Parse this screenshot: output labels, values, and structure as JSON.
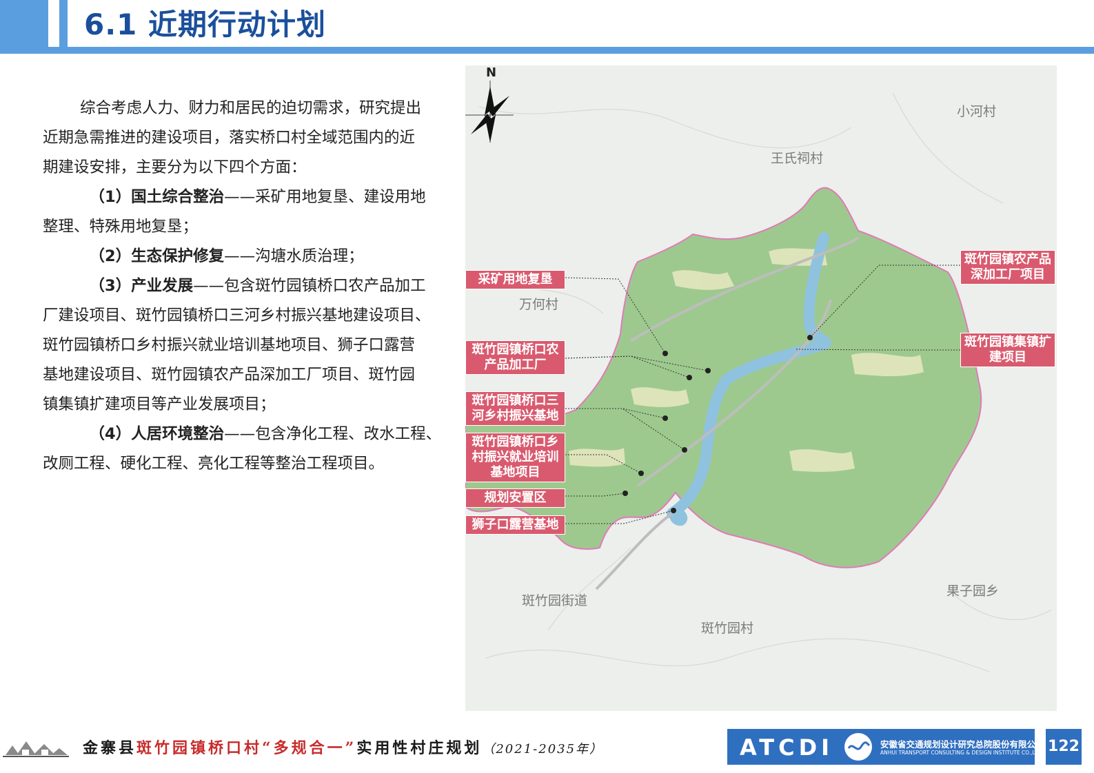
{
  "header": {
    "title": "6.1 近期行动计划"
  },
  "body": {
    "intro_line1": "综合考虑人力、财力和居民的迫切需求，研究提出",
    "intro_line2": "近期急需推进的建设项目，落实桥口村全域范围内的近",
    "intro_line3": "期建设安排，主要分为以下四个方面：",
    "item1_label": "（1）国土综合整治",
    "item1_text_a": "——采矿用地复垦、建设用地",
    "item1_text_b": "整理、特殊用地复垦；",
    "item2_label": "（2）生态保护修复",
    "item2_text": "——沟塘水质治理；",
    "item3_label": "（3）产业发展",
    "item3_text_a": "——包含斑竹园镇桥口农产品加工",
    "item3_text_b": "厂建设项目、斑竹园镇桥口三河乡村振兴基地建设项目、",
    "item3_text_c": "斑竹园镇桥口乡村振兴就业培训基地项目、狮子口露营",
    "item3_text_d": "基地建设项目、斑竹园镇农产品深加工厂项目、斑竹园",
    "item3_text_e": "镇集镇扩建项目等产业发展项目；",
    "item4_label": "（4）人居环境整治",
    "item4_text_a": "——包含净化工程、改水工程、",
    "item4_text_b": "改厕工程、硬化工程、亮化工程等整治工程项目。"
  },
  "map": {
    "compass_label": "N",
    "place_labels": {
      "xiaohe": "小河村",
      "wangshici": "王氏祠村",
      "wanhe": "万何村",
      "banzhuyuan_jiedao": "斑竹园街道",
      "banzhuyuan_cun": "斑竹园村",
      "guoziyuan": "果子园乡"
    },
    "callouts": {
      "caikuang": "采矿用地复垦",
      "nongchanpin_line1": "斑竹园镇桥口农",
      "nongchanpin_line2": "产品加工厂",
      "sanhe_line1": "斑竹园镇桥口三",
      "sanhe_line2": "河乡村振兴基地",
      "peixun_line1": "斑竹园镇桥口乡",
      "peixun_line2": "村振兴就业培训",
      "peixun_line3": "基地项目",
      "anzhi": "规划安置区",
      "shizikou": "狮子口露营基地",
      "shenjiagong_line1": "斑竹园镇农产品",
      "shenjiagong_line2": "深加工厂项目",
      "jizhen_line1": "斑竹园镇集镇扩",
      "jizhen_line2": "建项目"
    },
    "colors": {
      "callout": "#d95a6e",
      "village": "#9ec98e",
      "water": "#8fc2df",
      "boundary": "#e07ab8"
    }
  },
  "footer": {
    "title_a": "金寨县",
    "title_b": "斑竹园镇桥口村",
    "title_c": "“多规合一”",
    "title_d": "实用性村庄规划",
    "title_e": "（2021-2035年）",
    "logo_text": "ATCDI",
    "company_cn": "安徽省交通规划设计研究总院股份有限公司",
    "company_en": "ANHUI TRANSPORT CONSULTING & DESIGN INSTITUTE CO.,LTD.",
    "page_number": "122"
  }
}
